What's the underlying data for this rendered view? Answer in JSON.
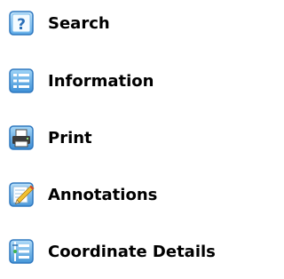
{
  "menu": {
    "items": [
      {
        "label": "Search",
        "icon": "help-question-icon"
      },
      {
        "label": "Information",
        "icon": "info-list-icon"
      },
      {
        "label": "Print",
        "icon": "printer-icon"
      },
      {
        "label": "Annotations",
        "icon": "pencil-note-icon"
      },
      {
        "label": "Coordinate Details",
        "icon": "coordinate-details-icon"
      }
    ]
  },
  "colors": {
    "icon_blue": "#3d8fd6",
    "icon_blue_light": "#9fd0f5",
    "pencil_yellow": "#f2c230",
    "pencil_red": "#d9432f",
    "text": "#000000"
  }
}
